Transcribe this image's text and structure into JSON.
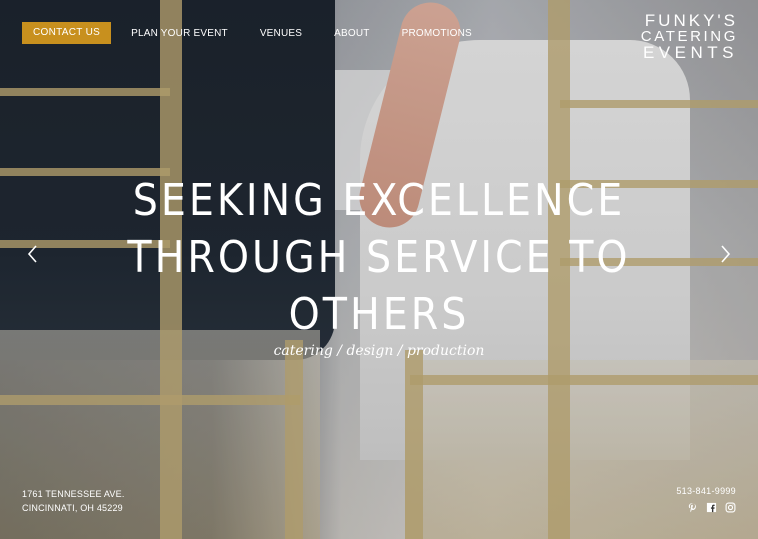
{
  "nav": {
    "contact_label": "CONTACT US",
    "items": [
      {
        "label": "PLAN YOUR EVENT"
      },
      {
        "label": "VENUES"
      },
      {
        "label": "ABOUT"
      },
      {
        "label": "PROMOTIONS"
      }
    ]
  },
  "logo": {
    "line1": "FUNKY'S",
    "line2": "CATERING",
    "line3": "EVENTS"
  },
  "hero": {
    "headline_line1": "SEEKING EXCELLENCE",
    "headline_line2": "THROUGH SERVICE TO",
    "headline_line3": "OTHERS",
    "tagline": "catering / design / production"
  },
  "footer": {
    "address_line1": "1761 TENNESSEE AVE.",
    "address_line2": "CINCINNATI, OH 45229",
    "phone": "513-841-9999"
  },
  "icons": {
    "left_arrow": "chevron-left-icon",
    "right_arrow": "chevron-right-icon",
    "social": [
      "pinterest-icon",
      "facebook-icon",
      "instagram-icon"
    ]
  },
  "colors": {
    "accent": "#c8901e",
    "text": "#ffffff"
  }
}
